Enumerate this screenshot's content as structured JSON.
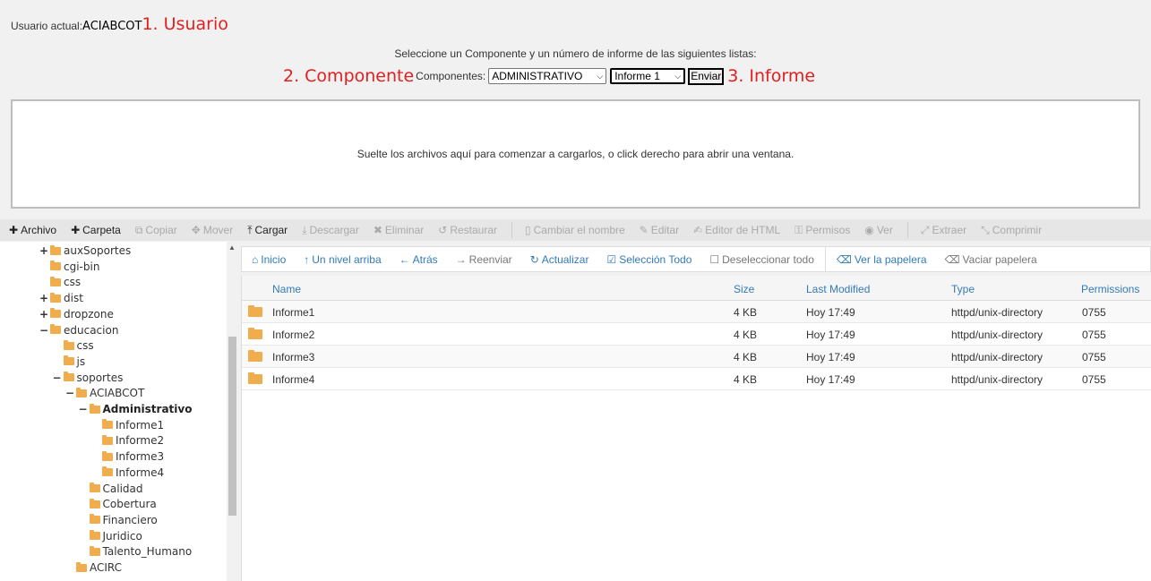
{
  "user": {
    "label": "Usuario actual:",
    "name": "ACIABCOT",
    "annotation": "1. Usuario"
  },
  "instructions": "Seleccione un Componente y un número de informe de las siguientes listas:",
  "component_row": {
    "annotation": "2. Componente",
    "label": "Componentes:",
    "component_selected": "ADMINISTRATIVO",
    "report_selected": "Informe 1",
    "send_label": "Enviar",
    "report_annotation": "3. Informe"
  },
  "dropzone_text": "Suelte los archivos aquí para comenzar a cargarlos, o click derecho para abrir una ventana.",
  "toolbar": [
    {
      "label": "Archivo",
      "icon": "plus-icon",
      "active": true
    },
    {
      "label": "Carpeta",
      "icon": "plus-icon",
      "active": true
    },
    {
      "label": "Copiar",
      "icon": "copy-icon",
      "active": false
    },
    {
      "label": "Mover",
      "icon": "move-icon",
      "active": false
    },
    {
      "label": "Cargar",
      "icon": "upload-icon",
      "active": true
    },
    {
      "label": "Descargar",
      "icon": "download-icon",
      "active": false
    },
    {
      "label": "Eliminar",
      "icon": "delete-icon",
      "active": false
    },
    {
      "label": "Restaurar",
      "icon": "restore-icon",
      "active": false
    },
    {
      "label": "Cambiar el nombre",
      "icon": "file-icon",
      "active": false
    },
    {
      "label": "Editar",
      "icon": "pencil-icon",
      "active": false
    },
    {
      "label": "Editor de HTML",
      "icon": "html-edit-icon",
      "active": false
    },
    {
      "label": "Permisos",
      "icon": "key-icon",
      "active": false
    },
    {
      "label": "Ver",
      "icon": "eye-icon",
      "active": false
    },
    {
      "label": "Extraer",
      "icon": "extract-icon",
      "active": false
    },
    {
      "label": "Comprimir",
      "icon": "compress-icon",
      "active": false
    }
  ],
  "tree": [
    {
      "label": "auxSoportes",
      "level": 0,
      "toggle": "+",
      "open": false,
      "bold": false
    },
    {
      "label": "cgi-bin",
      "level": 0,
      "toggle": "",
      "open": false,
      "bold": false
    },
    {
      "label": "css",
      "level": 0,
      "toggle": "",
      "open": false,
      "bold": false
    },
    {
      "label": "dist",
      "level": 0,
      "toggle": "+",
      "open": false,
      "bold": false
    },
    {
      "label": "dropzone",
      "level": 0,
      "toggle": "+",
      "open": false,
      "bold": false
    },
    {
      "label": "educacion",
      "level": 0,
      "toggle": "−",
      "open": true,
      "bold": false
    },
    {
      "label": "css",
      "level": 1,
      "toggle": "",
      "open": false,
      "bold": false
    },
    {
      "label": "js",
      "level": 1,
      "toggle": "",
      "open": false,
      "bold": false
    },
    {
      "label": "soportes",
      "level": 1,
      "toggle": "−",
      "open": true,
      "bold": false
    },
    {
      "label": "ACIABCOT",
      "level": 2,
      "toggle": "−",
      "open": true,
      "bold": false
    },
    {
      "label": "Administrativo",
      "level": 3,
      "toggle": "−",
      "open": true,
      "bold": true
    },
    {
      "label": "Informe1",
      "level": 4,
      "toggle": "",
      "open": false,
      "bold": false
    },
    {
      "label": "Informe2",
      "level": 4,
      "toggle": "",
      "open": false,
      "bold": false
    },
    {
      "label": "Informe3",
      "level": 4,
      "toggle": "",
      "open": false,
      "bold": false
    },
    {
      "label": "Informe4",
      "level": 4,
      "toggle": "",
      "open": false,
      "bold": false
    },
    {
      "label": "Calidad",
      "level": 3,
      "toggle": "",
      "open": false,
      "bold": false
    },
    {
      "label": "Cobertura",
      "level": 3,
      "toggle": "",
      "open": false,
      "bold": false
    },
    {
      "label": "Financiero",
      "level": 3,
      "toggle": "",
      "open": false,
      "bold": false
    },
    {
      "label": "Juridico",
      "level": 3,
      "toggle": "",
      "open": false,
      "bold": false
    },
    {
      "label": "Talento_Humano",
      "level": 3,
      "toggle": "",
      "open": false,
      "bold": false
    },
    {
      "label": "ACIRC",
      "level": 2,
      "toggle": "",
      "open": false,
      "bold": false
    }
  ],
  "nav": [
    {
      "label": "Inicio",
      "icon": "home-icon",
      "dim": false
    },
    {
      "label": "Un nivel arriba",
      "icon": "level-up-icon",
      "dim": false
    },
    {
      "label": "Atrás",
      "icon": "back-arrow-icon",
      "dim": false
    },
    {
      "label": "Reenviar",
      "icon": "forward-arrow-icon",
      "dim": true
    },
    {
      "label": "Actualizar",
      "icon": "refresh-icon",
      "dim": false
    },
    {
      "label": "Selección Todo",
      "icon": "checkbox-checked-icon",
      "dim": false
    },
    {
      "label": "Deseleccionar todo",
      "icon": "checkbox-empty-icon",
      "dim": true
    },
    {
      "label": "Ver la papelera",
      "icon": "trash-icon",
      "dim": false
    },
    {
      "label": "Vaciar papelera",
      "icon": "trash-icon",
      "dim": true
    }
  ],
  "file_columns": {
    "name": "Name",
    "size": "Size",
    "modified": "Last Modified",
    "type": "Type",
    "permissions": "Permissions"
  },
  "files": [
    {
      "name": "Informe1",
      "size": "4 KB",
      "modified": "Hoy 17:49",
      "type": "httpd/unix-directory",
      "permissions": "0755"
    },
    {
      "name": "Informe2",
      "size": "4 KB",
      "modified": "Hoy 17:49",
      "type": "httpd/unix-directory",
      "permissions": "0755"
    },
    {
      "name": "Informe3",
      "size": "4 KB",
      "modified": "Hoy 17:49",
      "type": "httpd/unix-directory",
      "permissions": "0755"
    },
    {
      "name": "Informe4",
      "size": "4 KB",
      "modified": "Hoy 17:49",
      "type": "httpd/unix-directory",
      "permissions": "0755"
    }
  ],
  "colors": {
    "annotation": "#e02020",
    "link": "#337ab7",
    "folder": "#f0ad4e"
  }
}
